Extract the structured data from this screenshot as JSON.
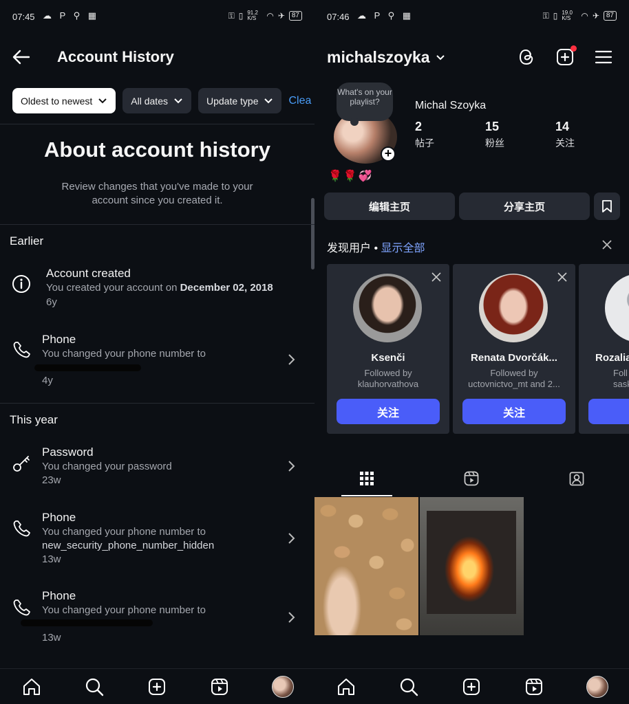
{
  "left": {
    "status": {
      "time": "07:45",
      "notif": "☁ P ⚲ ▦",
      "sys": "91.2 K/S",
      "battery": "87"
    },
    "header": {
      "title": "Account History"
    },
    "filters": {
      "sort": "Oldest to newest",
      "dates": "All dates",
      "type": "Update type",
      "clear": "Clea"
    },
    "about": {
      "title": "About account history",
      "desc": "Review changes that you've made to your account since you created it."
    },
    "sections": [
      {
        "heading": "Earlier"
      },
      {
        "heading": "This year"
      }
    ],
    "items": [
      {
        "title": "Account created",
        "desc": "You created your account on ",
        "desc_bold": "December 02, 2018",
        "ago": "6y"
      },
      {
        "title": "Phone",
        "desc": "You changed your phone number to",
        "ago": "4y"
      },
      {
        "title": "Password",
        "desc": "You changed your password",
        "ago": "23w"
      },
      {
        "title": "Phone",
        "desc": "You changed your phone number to",
        "value": "new_security_phone_number_hidden",
        "ago": "13w"
      },
      {
        "title": "Phone",
        "desc": "You changed your phone number to",
        "ago": "13w"
      }
    ]
  },
  "right": {
    "status": {
      "time": "07:46",
      "notif": "☁ P ⚲ ▦",
      "sys": "19.0 K/S",
      "battery": "87"
    },
    "username": "michalszoyka",
    "note": "What's on your playlist?",
    "full_name": "Michal Szoyka",
    "stats": [
      {
        "n": "2",
        "l": "帖子"
      },
      {
        "n": "15",
        "l": "粉丝"
      },
      {
        "n": "14",
        "l": "关注"
      }
    ],
    "bio": "🌹🌹💞",
    "buttons": {
      "edit": "编辑主页",
      "share": "分享主页"
    },
    "discover": {
      "label": "发现用户",
      "sep": " • ",
      "all": "显示全部"
    },
    "suggestions": [
      {
        "name": "Ksenči",
        "by": "Followed by",
        "by2": "klauhorvathova",
        "follow": "关注"
      },
      {
        "name": "Renata Dvorčák...",
        "by": "Followed by",
        "by2": "uctovnictvo_mt and 2...",
        "follow": "关注"
      },
      {
        "name": "Rozalia",
        "by": "Foll",
        "by2": "saska",
        "follow": ""
      }
    ]
  },
  "icons": {
    "left_nav": [
      "home-icon",
      "search-icon",
      "create-icon",
      "reels-icon",
      "profile-avatar"
    ],
    "right_nav": [
      "home-icon",
      "search-icon",
      "create-icon",
      "reels-icon",
      "profile-avatar"
    ]
  },
  "colors": {
    "accent_blue": "#4a5df9",
    "link_blue": "#4a9df8",
    "bg": "#0c0f14",
    "card": "#262a33"
  }
}
